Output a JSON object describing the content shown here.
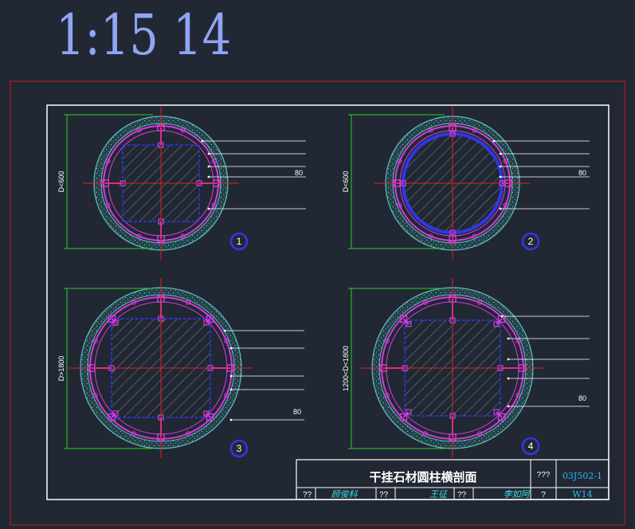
{
  "header": {
    "scale_label": "1:15 14"
  },
  "details": [
    {
      "number": "1",
      "dimension": "D<600",
      "callout": "80"
    },
    {
      "number": "2",
      "dimension": "D<600",
      "callout": "80"
    },
    {
      "number": "3",
      "dimension": "D>1800",
      "callout": "80"
    },
    {
      "number": "4",
      "dimension": "1200<D<1800",
      "callout": "80"
    }
  ],
  "title_block": {
    "title": "干挂石材圆柱横剖面",
    "atlas_label": "???",
    "atlas_code": "03J502-1",
    "row_labels": [
      "??",
      "??",
      "??",
      "?"
    ],
    "signatures": [
      "顾俊科",
      "王征",
      "李如阿"
    ],
    "page_code": "W14"
  },
  "colors": {
    "background": "#212833",
    "border_red": "#c01b1b",
    "frame_white": "#ffffff",
    "stone_cyan": "#5fbfbf",
    "bracket_magenta": "#d63ce0",
    "core_blue": "#2f37e8",
    "dimension_green": "#26d126",
    "centerline_red": "#e02020"
  }
}
